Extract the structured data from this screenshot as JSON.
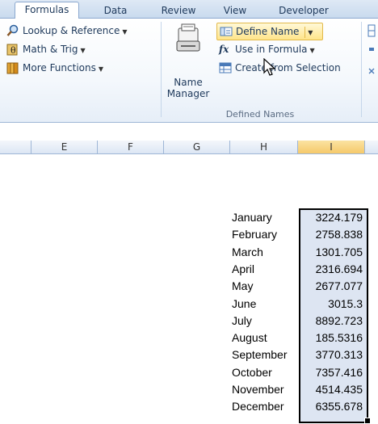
{
  "tabs": [
    "Formulas",
    "Data",
    "Review",
    "View",
    "Developer"
  ],
  "ribbon": {
    "function_library": {
      "lookup": "Lookup & Reference",
      "math": "Math & Trig",
      "more": "More Functions"
    },
    "defined_names": {
      "name_manager_line1": "Name",
      "name_manager_line2": "Manager",
      "define_name": "Define Name",
      "use_in_formula": "Use in Formula",
      "create_from_selection": "Create from Selection",
      "group_label": "Defined Names"
    }
  },
  "columns": [
    "E",
    "F",
    "G",
    "H",
    "I"
  ],
  "selected_column": "I",
  "rows": [
    {
      "month": "January",
      "value": "3224.179"
    },
    {
      "month": "February",
      "value": "2758.838"
    },
    {
      "month": "March",
      "value": "1301.705"
    },
    {
      "month": "April",
      "value": "2316.694"
    },
    {
      "month": "May",
      "value": "2677.077"
    },
    {
      "month": "June",
      "value": "3015.3"
    },
    {
      "month": "July",
      "value": "8892.723"
    },
    {
      "month": "August",
      "value": "185.5316"
    },
    {
      "month": "September",
      "value": "3770.313"
    },
    {
      "month": "October",
      "value": "7357.416"
    },
    {
      "month": "November",
      "value": "4514.435"
    },
    {
      "month": "December",
      "value": "6355.678"
    }
  ],
  "colors": {
    "selection_fill": "#dde5f2",
    "header_highlight": "#f5c96a",
    "ribbon_text": "#1e395b"
  }
}
